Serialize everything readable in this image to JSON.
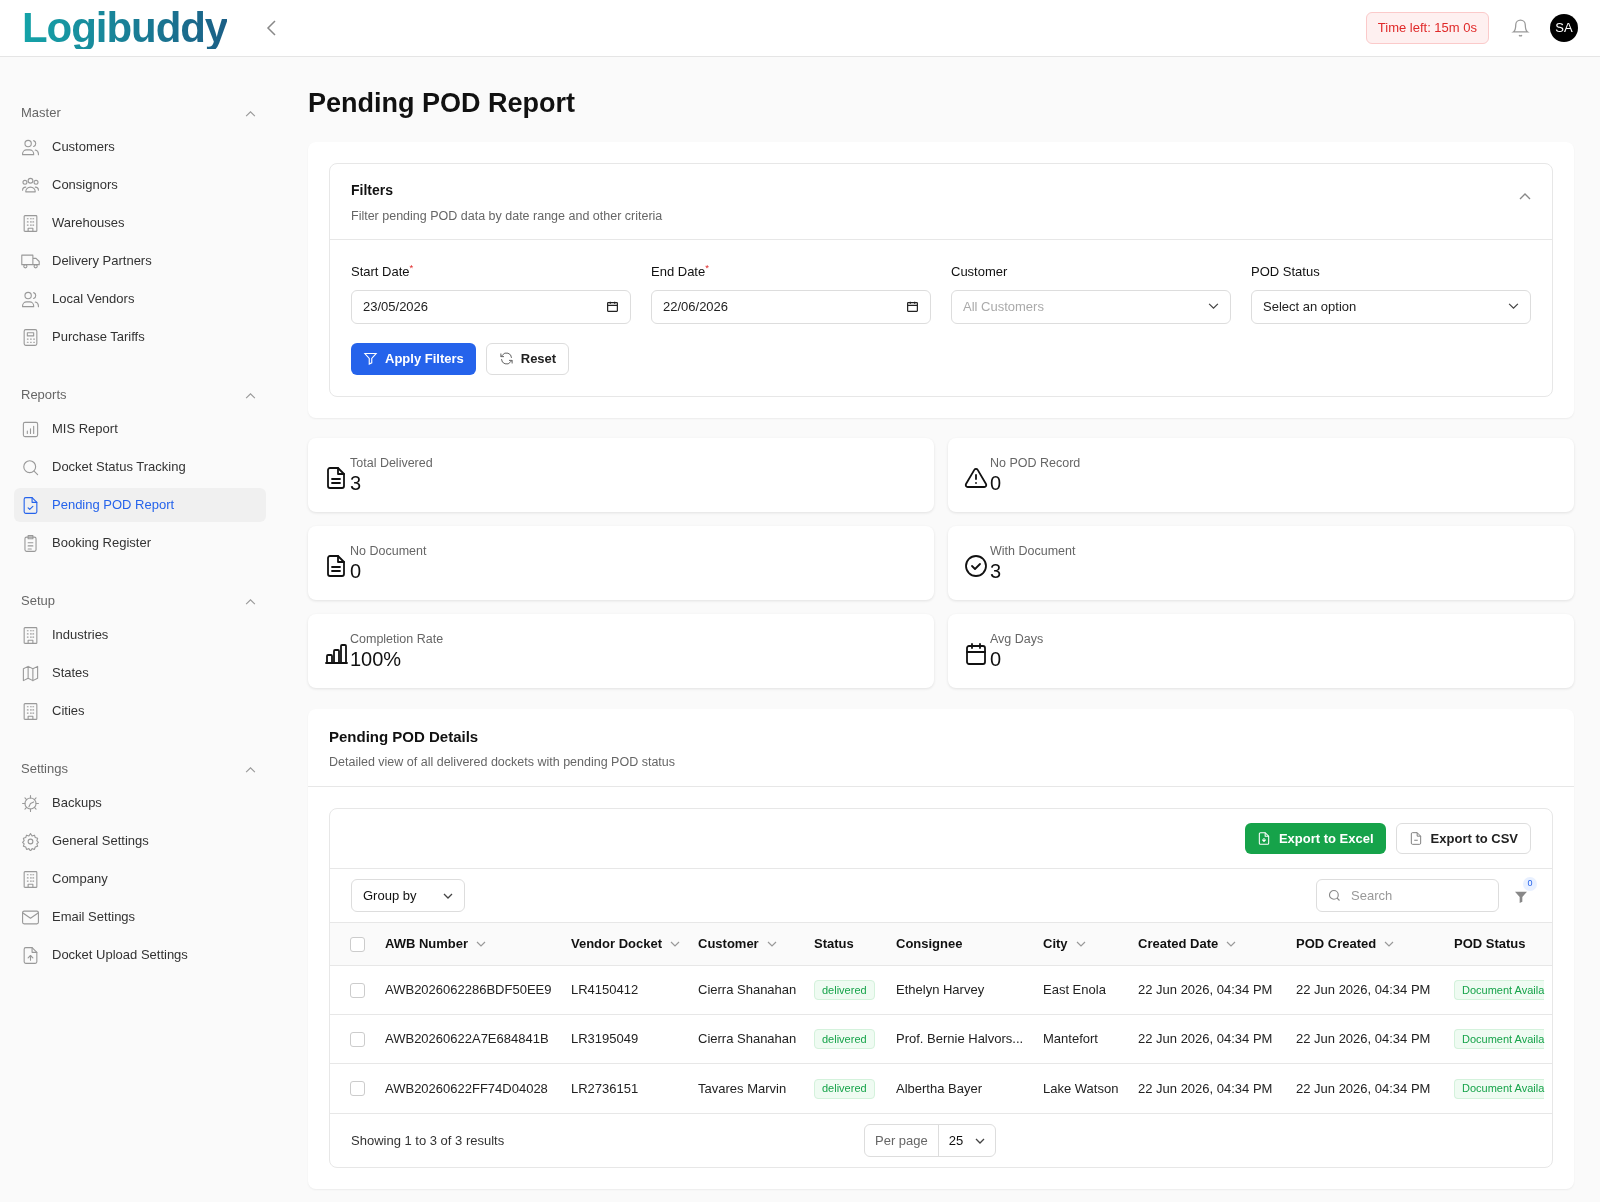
{
  "header": {
    "logo": "Logibuddy",
    "timer": "Time left: 15m 0s",
    "avatar": "SA"
  },
  "sidebar": {
    "sections": [
      {
        "title": "Master",
        "expanded": true,
        "items": [
          {
            "label": "Customers",
            "selected": false
          },
          {
            "label": "Consignors",
            "selected": false
          },
          {
            "label": "Warehouses",
            "selected": false
          },
          {
            "label": "Delivery Partners",
            "selected": false
          },
          {
            "label": "Local Vendors",
            "selected": false
          },
          {
            "label": "Purchase Tariffs",
            "selected": false
          }
        ]
      },
      {
        "title": "Reports",
        "expanded": true,
        "items": [
          {
            "label": "MIS Report",
            "selected": false
          },
          {
            "label": "Docket Status Tracking",
            "selected": false
          },
          {
            "label": "Pending POD Report",
            "selected": true
          },
          {
            "label": "Booking Register",
            "selected": false
          }
        ]
      },
      {
        "title": "Setup",
        "expanded": true,
        "items": [
          {
            "label": "Industries",
            "selected": false
          },
          {
            "label": "States",
            "selected": false
          },
          {
            "label": "Cities",
            "selected": false
          }
        ]
      },
      {
        "title": "Settings",
        "expanded": true,
        "items": [
          {
            "label": "Backups",
            "selected": false
          },
          {
            "label": "General Settings",
            "selected": false
          },
          {
            "label": "Company",
            "selected": false
          },
          {
            "label": "Email Settings",
            "selected": false
          },
          {
            "label": "Docket Upload Settings",
            "selected": false
          }
        ]
      }
    ]
  },
  "page_title": "Pending POD Report",
  "filters": {
    "title": "Filters",
    "subtitle": "Filter pending POD data by date range and other criteria",
    "expanded": true,
    "fields": [
      {
        "label": "Start Date$^{*}$",
        "kind": "date",
        "value": "23/05/2026"
      },
      {
        "label": "End Date$^{*}$",
        "kind": "date",
        "value": "22/06/2026"
      },
      {
        "label": "Customer",
        "kind": "select",
        "placeholder": "All Customers"
      },
      {
        "label": "POD Status",
        "kind": "select",
        "value": "Select an option"
      }
    ],
    "buttons": [
      {
        "label": "Apply Filters",
        "kind": "primary"
      },
      {
        "label": "Reset",
        "kind": "secondary"
      }
    ]
  },
  "stats": [
    {
      "label": "Total Delivered",
      "value": "3"
    },
    {
      "label": "No POD Record",
      "value": "0"
    },
    {
      "label": "No Document",
      "value": "0"
    },
    {
      "label": "With Document",
      "value": "3"
    },
    {
      "label": "Completion Rate",
      "value": "100%"
    },
    {
      "label": "Avg Days",
      "value": "0"
    }
  ],
  "details": {
    "title": "Pending POD Details",
    "subtitle": "Detailed view of all delivered dockets with pending POD status",
    "export_buttons": [
      {
        "label": "Export to Excel",
        "kind": "primary"
      },
      {
        "label": "Export to CSV",
        "kind": "secondary"
      }
    ],
    "group_by": "Group by",
    "search_placeholder": "Search",
    "filter_count": "0",
    "all_selected": false,
    "columns": [
      {
        "label": "AWB Number",
        "sortable": true
      },
      {
        "label": "Vendor Docket",
        "sortable": true
      },
      {
        "label": "Customer",
        "sortable": true
      },
      {
        "label": "Status",
        "sortable": false
      },
      {
        "label": "Consignee",
        "sortable": false
      },
      {
        "label": "City",
        "sortable": true
      },
      {
        "label": "Created Date",
        "sortable": true
      },
      {
        "label": "POD Created",
        "sortable": true
      },
      {
        "label": "POD Status",
        "sortable": false
      }
    ],
    "rows": [
      {
        "selected": false,
        "awb": "AWB2026062286BDF50EE9",
        "vendor_docket": "LR4150412",
        "customer": "Cierra Shanahan",
        "status": "delivered",
        "consignee": "Ethelyn Harvey",
        "city": "East Enola",
        "created_date": "22 Jun 2026, 04:34 PM",
        "pod_created": "22 Jun 2026, 04:34 PM",
        "pod_status": "Document Availa"
      },
      {
        "selected": false,
        "awb": "AWB20260622A7E684841B",
        "vendor_docket": "LR3195049",
        "customer": "Cierra Shanahan",
        "status": "delivered",
        "consignee": "Prof. Bernie Halvors...",
        "city": "Mantefort",
        "created_date": "22 Jun 2026, 04:34 PM",
        "pod_created": "22 Jun 2026, 04:34 PM",
        "pod_status": "Document Availa"
      },
      {
        "selected": false,
        "awb": "AWB20260622FF74D04028",
        "vendor_docket": "LR2736151",
        "customer": "Tavares Marvin",
        "status": "delivered",
        "consignee": "Albertha Bayer",
        "city": "Lake Watson",
        "created_date": "22 Jun 2026, 04:34 PM",
        "pod_created": "22 Jun 2026, 04:34 PM",
        "pod_status": "Document Availa"
      }
    ],
    "footer": "Showing 1 to 3 of 3 results",
    "per_page_label": "Per page",
    "per_page": "25"
  }
}
